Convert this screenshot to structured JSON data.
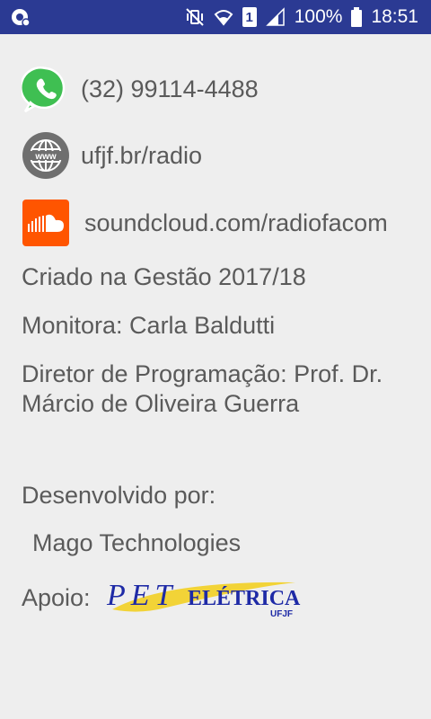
{
  "status_bar": {
    "battery_percent": "100%",
    "time": "18:51",
    "sim_slot": "1"
  },
  "contacts": {
    "whatsapp": "(32) 99114-4488",
    "website": "ufjf.br/radio",
    "soundcloud": "soundcloud.com/radiofacom"
  },
  "info": {
    "created": "Criado na Gestão 2017/18",
    "monitor": "Monitora: Carla Baldutti",
    "director_line1": "Diretor de Programação: Prof. Dr.",
    "director_line2": "Márcio de Oliveira Guerra",
    "developed_by": "Desenvolvido por:",
    "developer": "Mago Technologies",
    "support": "Apoio:"
  },
  "logo": {
    "pet": "PET",
    "eletrica": "ELÉTRICA",
    "ufjf": "UFJF"
  },
  "colors": {
    "status_bar": "#2b3a93",
    "whatsapp": "#3fbf52",
    "soundcloud": "#ff5500",
    "globe": "#6f6f6f",
    "text": "#5a5a5a",
    "pet_blue": "#1e2aa6",
    "pet_yellow": "#f2d337"
  }
}
